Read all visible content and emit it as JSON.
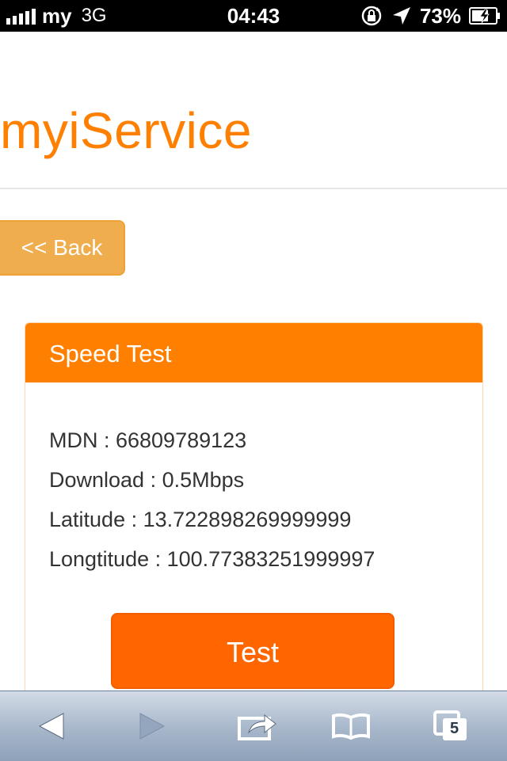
{
  "status_bar": {
    "carrier": "my",
    "network": "3G",
    "time": "04:43",
    "battery": "73%"
  },
  "header": {
    "title": "myiService"
  },
  "back_button": {
    "label": "<< Back"
  },
  "panel": {
    "heading": "Speed Test",
    "rows": [
      "MDN : 66809789123",
      "Download : 0.5Mbps",
      "Latitude : 13.722898269999999",
      "Longtitude : 100.77383251999997"
    ],
    "test_button": "Test"
  },
  "toolbar": {
    "tabs_count": "5"
  },
  "colors": {
    "accent": "#ff8000",
    "button_primary": "#ff6600",
    "button_warning": "#f0ad4e"
  }
}
